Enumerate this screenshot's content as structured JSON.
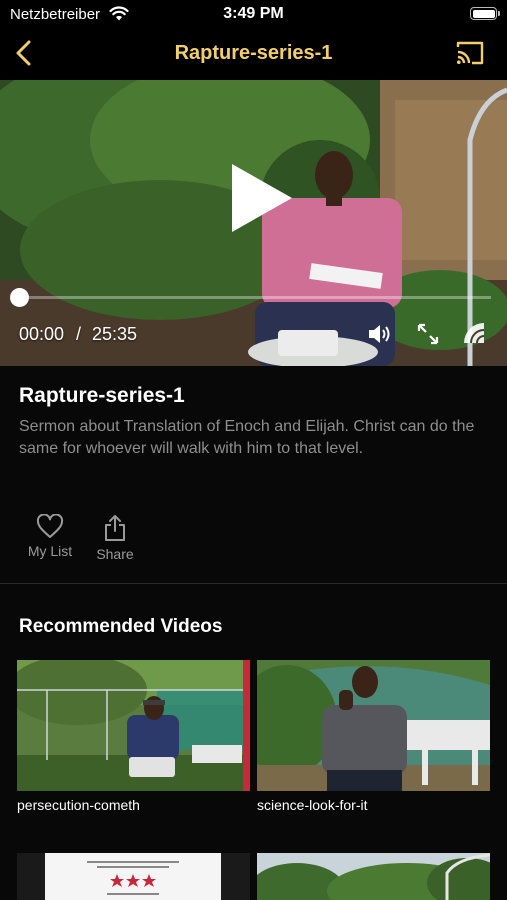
{
  "status_bar": {
    "carrier": "Netzbetreiber",
    "time": "3:49 PM"
  },
  "nav": {
    "title": "Rapture-series-1"
  },
  "player": {
    "current_time": "00:00",
    "separator": "/",
    "duration": "25:35",
    "progress_fraction": 0.0
  },
  "video": {
    "title": "Rapture-series-1",
    "description": "Sermon about Translation of Enoch and Elijah. Christ can do the same for whoever will walk with him to that level."
  },
  "actions": {
    "my_list": "My List",
    "share": "Share"
  },
  "recommended": {
    "heading": "Recommended Videos",
    "items": [
      {
        "title": "persecution-cometh"
      },
      {
        "title": "science-look-for-it"
      }
    ]
  },
  "theme": {
    "accent": "#f3cf6b",
    "background": "#080808",
    "muted_text": "#8e8e8e"
  }
}
